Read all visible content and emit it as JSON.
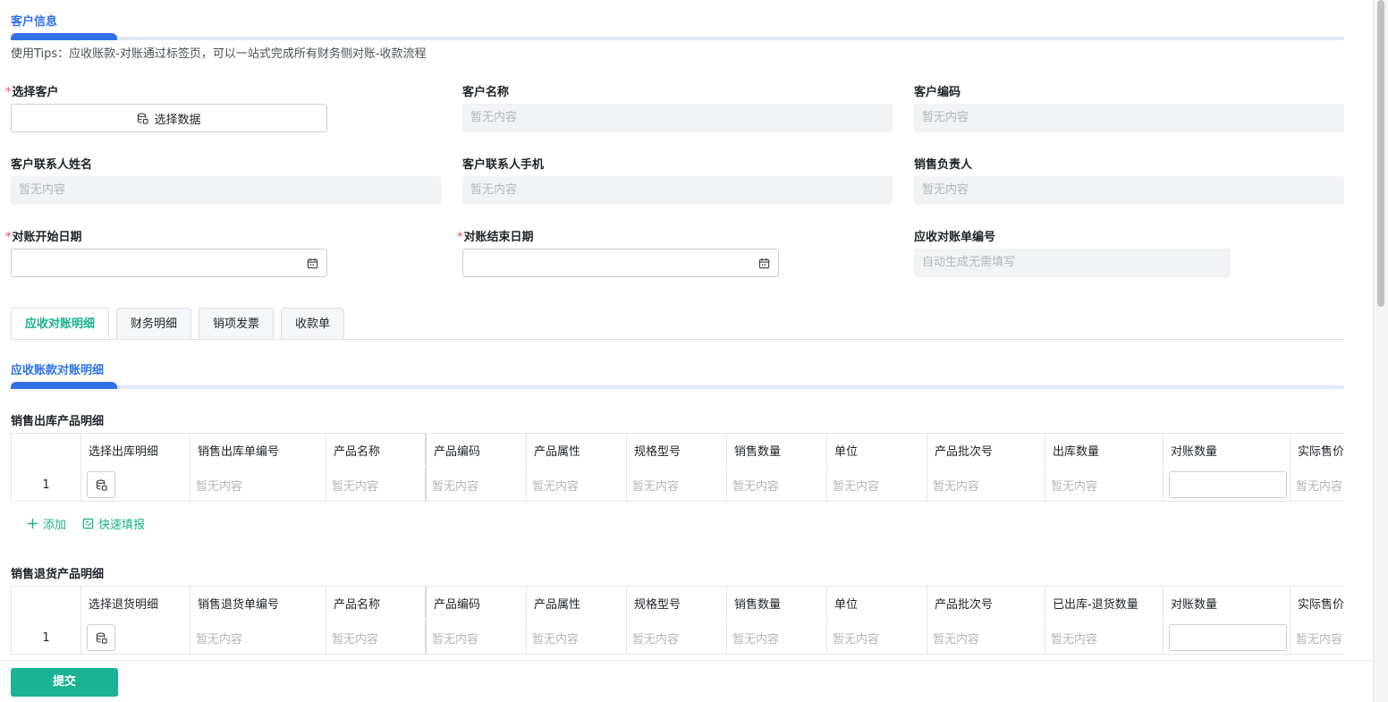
{
  "customer_section": {
    "title": "客户信息"
  },
  "tips": "使用Tips：应收账款-对账通过标签页，可以一站式完成所有财务侧对账-收款流程",
  "empty_text": "暂无内容",
  "form": {
    "select_customer": {
      "label": "选择客户",
      "required": true,
      "button": "选择数据"
    },
    "customer_name": {
      "label": "客户名称",
      "value": "暂无内容"
    },
    "customer_code": {
      "label": "客户编码",
      "value": "暂无内容"
    },
    "contact_name": {
      "label": "客户联系人姓名",
      "value": "暂无内容"
    },
    "contact_phone": {
      "label": "客户联系人手机",
      "value": "暂无内容"
    },
    "sales_owner": {
      "label": "销售负责人",
      "value": "暂无内容"
    },
    "start_date": {
      "label": "对账开始日期",
      "required": true,
      "value": ""
    },
    "end_date": {
      "label": "对账结束日期",
      "required": true,
      "value": ""
    },
    "statement_no": {
      "label": "应收对账单编号",
      "value": "自动生成无需填写"
    }
  },
  "tabs": [
    {
      "label": "应收对账明细",
      "active": true
    },
    {
      "label": "财务明细",
      "active": false
    },
    {
      "label": "销项发票",
      "active": false
    },
    {
      "label": "收款单",
      "active": false
    }
  ],
  "detail_section": {
    "title": "应收账款对账明细"
  },
  "outbound_table": {
    "title": "销售出库产品明细",
    "columns": [
      "",
      "选择出库明细",
      "销售出库单编号",
      "产品名称",
      "产品编码",
      "产品属性",
      "规格型号",
      "销售数量",
      "单位",
      "产品批次号",
      "出库数量",
      "对账数量",
      "实际售价"
    ],
    "rows": [
      {
        "index": "1",
        "cells": [
          "暂无内容",
          "暂无内容",
          "暂无内容",
          "暂无内容",
          "暂无内容",
          "暂无内容",
          "暂无内容",
          "暂无内容",
          "暂无内容",
          "",
          "暂无内容"
        ]
      }
    ]
  },
  "actions": {
    "add": "添加",
    "quick_fill": "快速填报"
  },
  "return_table": {
    "title": "销售退货产品明细",
    "columns": [
      "",
      "选择退货明细",
      "销售退货单编号",
      "产品名称",
      "产品编码",
      "产品属性",
      "规格型号",
      "销售数量",
      "单位",
      "产品批次号",
      "已出库-退货数量",
      "对账数量",
      "实际售价"
    ],
    "rows": [
      {
        "index": "1",
        "cells": [
          "暂无内容",
          "暂无内容",
          "暂无内容",
          "暂无内容",
          "暂无内容",
          "暂无内容",
          "暂无内容",
          "暂无内容",
          "暂无内容",
          "",
          "暂无内容"
        ]
      }
    ]
  },
  "footer": {
    "submit": "提交"
  },
  "colors": {
    "primary": "#1ab394",
    "accent_blue": "#3370e8",
    "required": "#f54a45"
  }
}
